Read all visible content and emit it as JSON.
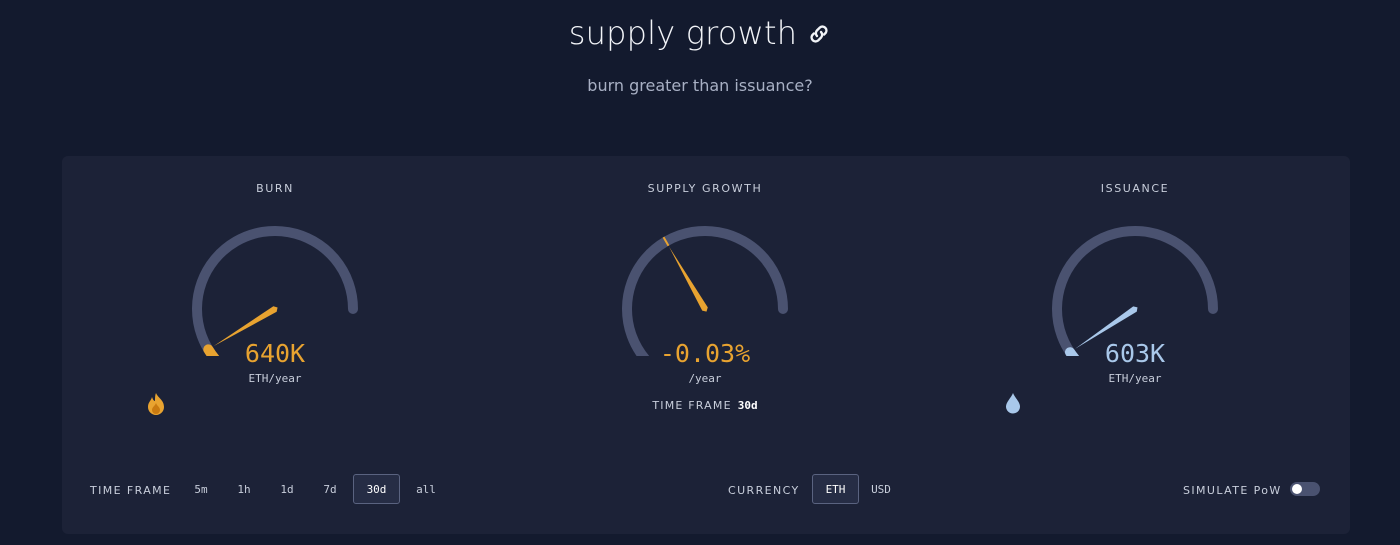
{
  "header": {
    "title": "supply growth",
    "subtitle": "burn greater than issuance?"
  },
  "gauges": {
    "burn": {
      "label": "BURN",
      "value": "640K",
      "unit": "ETH/year",
      "icon": "flame-icon",
      "color": "#e8a330",
      "level": 0.12
    },
    "supply_growth": {
      "label": "SUPPLY GROWTH",
      "value": "-0.03%",
      "unit": "/year",
      "timeframe_label": "TIME FRAME",
      "timeframe_value": "30d",
      "color": "#e8a330",
      "level": 0.5
    },
    "issuance": {
      "label": "ISSUANCE",
      "value": "603K",
      "unit": "ETH/year",
      "icon": "droplet-icon",
      "color": "#a9c8ea",
      "level": 0.11
    }
  },
  "controls": {
    "timeframe_label": "TIME FRAME",
    "timeframes": [
      "5m",
      "1h",
      "1d",
      "7d",
      "30d",
      "all"
    ],
    "timeframe_selected": "30d",
    "currency_label": "CURRENCY",
    "currencies": [
      "ETH",
      "USD"
    ],
    "currency_selected": "ETH",
    "simulate_label": "SIMULATE PoW",
    "simulate_on": false
  },
  "colors": {
    "background": "#131a2e",
    "card": "#1c2237",
    "track": "#4a5270",
    "burn": "#e8a330",
    "issuance": "#a9c8ea"
  }
}
